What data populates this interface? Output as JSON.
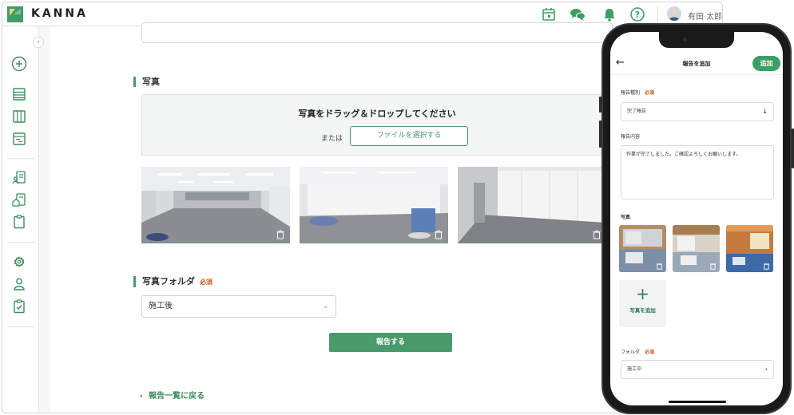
{
  "app": {
    "brand": "KANNA",
    "user_name": "有田 太郎"
  },
  "header_icons": [
    "calendar-icon",
    "chat-icon",
    "bell-icon",
    "help-icon"
  ],
  "photos_section": {
    "title": "写真",
    "dropzone_title": "写真をドラッグ＆ドロップしてください",
    "or_text": "または",
    "select_file_label": "ファイルを選択する"
  },
  "folder_section": {
    "title": "写真フォルダ",
    "required": "必須",
    "selected": "施工後"
  },
  "submit_label": "報告する",
  "back_link": "報告一覧に戻る",
  "mobile": {
    "title": "報告を追加",
    "add_label": "追加",
    "report_type": {
      "label": "報告種別",
      "required": "必須",
      "value": "完了報告"
    },
    "report_content": {
      "label": "報告内容",
      "value": "作業が完了しました。ご確認よろしくお願いします。"
    },
    "photos_label": "写真",
    "add_photo_label": "写真を追加",
    "folder": {
      "label": "フォルダ",
      "required": "必須",
      "value": "施工中"
    }
  },
  "colors": {
    "accent": "#4a9a6c",
    "required": "#c85a1c"
  }
}
